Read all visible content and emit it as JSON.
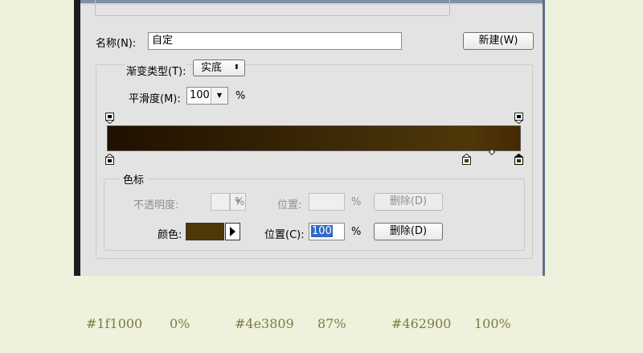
{
  "dialog": {
    "name_label": "名称(N):",
    "name_value": "自定",
    "new_button": "新建(W)",
    "gradient_type_label": "渐变类型(T):",
    "gradient_type_value": "实底",
    "smoothness_label": "平滑度(M):",
    "smoothness_value": "100",
    "percent": "%",
    "color_stops_group": "色标",
    "opacity_label": "不透明度:",
    "position_label": "位置:",
    "delete_button": "删除(D)",
    "color_label": "颜色:",
    "color_position_label": "位置(C):",
    "color_position_value": "100",
    "selected_color": "#4e3809"
  },
  "gradient": {
    "stops": [
      {
        "color": "#1f1000",
        "position": 0
      },
      {
        "color": "#4e3809",
        "position": 87
      },
      {
        "color": "#462900",
        "position": 100
      }
    ]
  },
  "footer": {
    "items": [
      {
        "hex": "#1f1000",
        "pct": "0%"
      },
      {
        "hex": "#4e3809",
        "pct": "87%"
      },
      {
        "hex": "#462900",
        "pct": "100%"
      }
    ]
  }
}
